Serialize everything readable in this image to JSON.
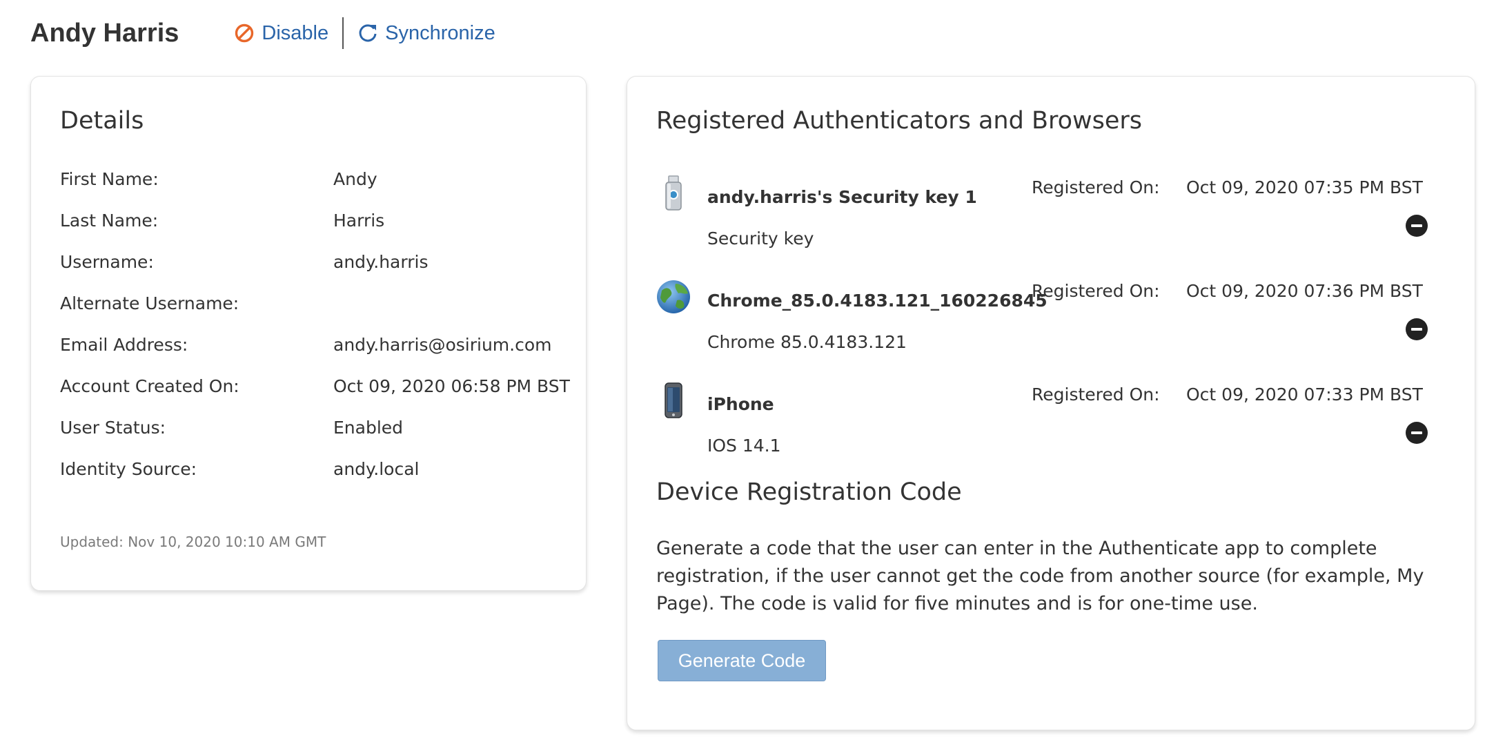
{
  "header": {
    "user_name": "Andy Harris",
    "disable_label": "Disable",
    "synchronize_label": "Synchronize",
    "colors": {
      "disable_icon": "#e8672a",
      "link": "#2a64a9"
    }
  },
  "details": {
    "title": "Details",
    "rows": [
      {
        "label": "First Name:",
        "value": "Andy"
      },
      {
        "label": "Last Name:",
        "value": "Harris"
      },
      {
        "label": "Username:",
        "value": "andy.harris"
      },
      {
        "label": "Alternate Username:",
        "value": ""
      },
      {
        "label": "Email Address:",
        "value": "andy.harris@osirium.com"
      },
      {
        "label": "Account Created On:",
        "value": "Oct 09, 2020 06:58 PM BST"
      },
      {
        "label": "User Status:",
        "value": "Enabled"
      },
      {
        "label": "Identity Source:",
        "value": "andy.local"
      }
    ],
    "updated": "Updated: Nov 10, 2020 10:10 AM GMT"
  },
  "authenticators": {
    "title": "Registered Authenticators and Browsers",
    "items": [
      {
        "icon": "usb-security-key-icon",
        "name": "andy.harris's Security key 1",
        "type": "Security key",
        "registered_label": "Registered On:",
        "registered_on": "Oct 09, 2020 07:35 PM BST"
      },
      {
        "icon": "globe-icon",
        "name": "Chrome_85.0.4183.121_160226845",
        "type": "Chrome 85.0.4183.121",
        "registered_label": "Registered On:",
        "registered_on": "Oct 09, 2020 07:36 PM BST"
      },
      {
        "icon": "mobile-phone-icon",
        "name": "iPhone",
        "type": "IOS 14.1",
        "registered_label": "Registered On:",
        "registered_on": "Oct 09, 2020 07:33 PM BST"
      }
    ]
  },
  "device_registration": {
    "title": "Device Registration Code",
    "description": "Generate a code that the user can enter in the Authenticate app to complete registration, if the user cannot get the code from another source (for example, My Page). The code is valid for five minutes and is for one-time use.",
    "button_label": "Generate Code",
    "button_color": "#87afd6"
  }
}
